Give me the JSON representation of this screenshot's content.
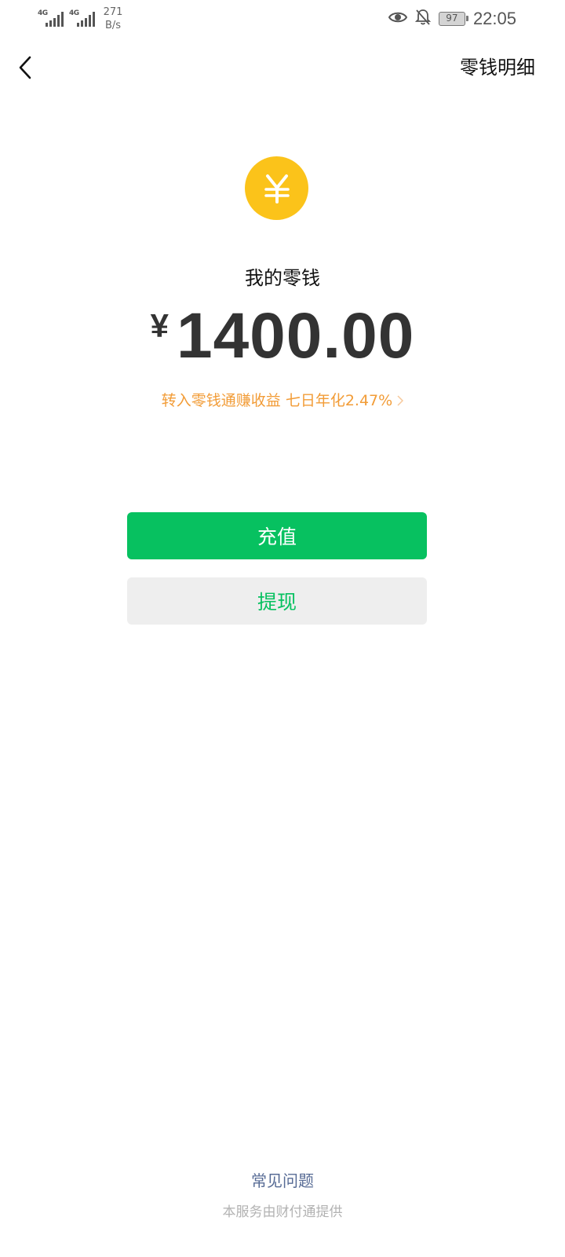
{
  "status_bar": {
    "network_1": "4G",
    "network_2": "4G",
    "speed_value": "271",
    "speed_unit": "B/s",
    "battery": "97",
    "time": "22:05",
    "icons": [
      "eye-icon",
      "bell-off-icon"
    ]
  },
  "nav": {
    "back_icon": "chevron-left-icon",
    "detail_label": "零钱明细"
  },
  "wallet": {
    "icon": "yuan-coin-icon",
    "accent_color": "#fbc31a",
    "label": "我的零钱",
    "currency_symbol": "¥",
    "balance": "1400.00",
    "promo_text": "转入零钱通赚收益 七日年化2.47%",
    "promo_color": "#f29c37"
  },
  "actions": {
    "recharge_label": "充值",
    "withdraw_label": "提现",
    "primary_color": "#07c160"
  },
  "footer": {
    "faq_label": "常见问题",
    "provider_text": "本服务由财付通提供"
  }
}
